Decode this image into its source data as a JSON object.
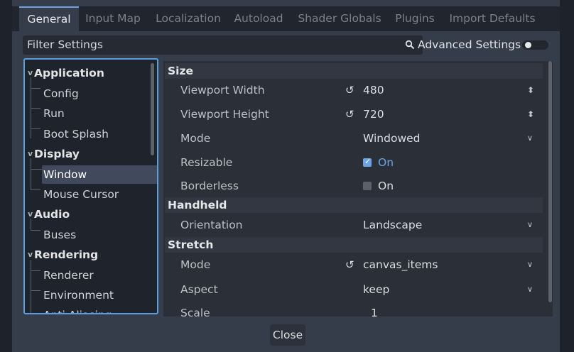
{
  "tabs": [
    {
      "label": "General",
      "active": true
    },
    {
      "label": "Input Map"
    },
    {
      "label": "Localization"
    },
    {
      "label": "Autoload"
    },
    {
      "label": "Shader Globals"
    },
    {
      "label": "Plugins"
    },
    {
      "label": "Import Defaults"
    }
  ],
  "filter": {
    "placeholder": "Filter Settings",
    "icon": "search-icon"
  },
  "advanced": {
    "label": "Advanced Settings",
    "enabled": false
  },
  "tree": {
    "groups": [
      {
        "label": "Application",
        "items": [
          "Config",
          "Run",
          "Boot Splash"
        ]
      },
      {
        "label": "Display",
        "items": [
          "Window",
          "Mouse Cursor"
        ]
      },
      {
        "label": "Audio",
        "items": [
          "Buses"
        ]
      },
      {
        "label": "Rendering",
        "items": [
          "Renderer",
          "Environment",
          "Anti Aliasing"
        ]
      }
    ],
    "selected": "Window"
  },
  "inspector": {
    "size": {
      "title": "Size",
      "viewport_width": {
        "label": "Viewport Width",
        "value": "480"
      },
      "viewport_height": {
        "label": "Viewport Height",
        "value": "720"
      },
      "mode": {
        "label": "Mode",
        "value": "Windowed"
      },
      "resizable": {
        "label": "Resizable",
        "value": "On",
        "checked": true
      },
      "borderless": {
        "label": "Borderless",
        "value": "On",
        "checked": false
      }
    },
    "handheld": {
      "title": "Handheld",
      "orientation": {
        "label": "Orientation",
        "value": "Landscape"
      }
    },
    "stretch": {
      "title": "Stretch",
      "mode": {
        "label": "Mode",
        "value": "canvas_items"
      },
      "aspect": {
        "label": "Aspect",
        "value": "keep"
      },
      "scale": {
        "label": "Scale",
        "value": "1"
      }
    }
  },
  "footer": {
    "close_label": "Close"
  },
  "colors": {
    "accent": "#6ea3e6",
    "background": "#363d4a",
    "panel": "#2a2f38"
  }
}
